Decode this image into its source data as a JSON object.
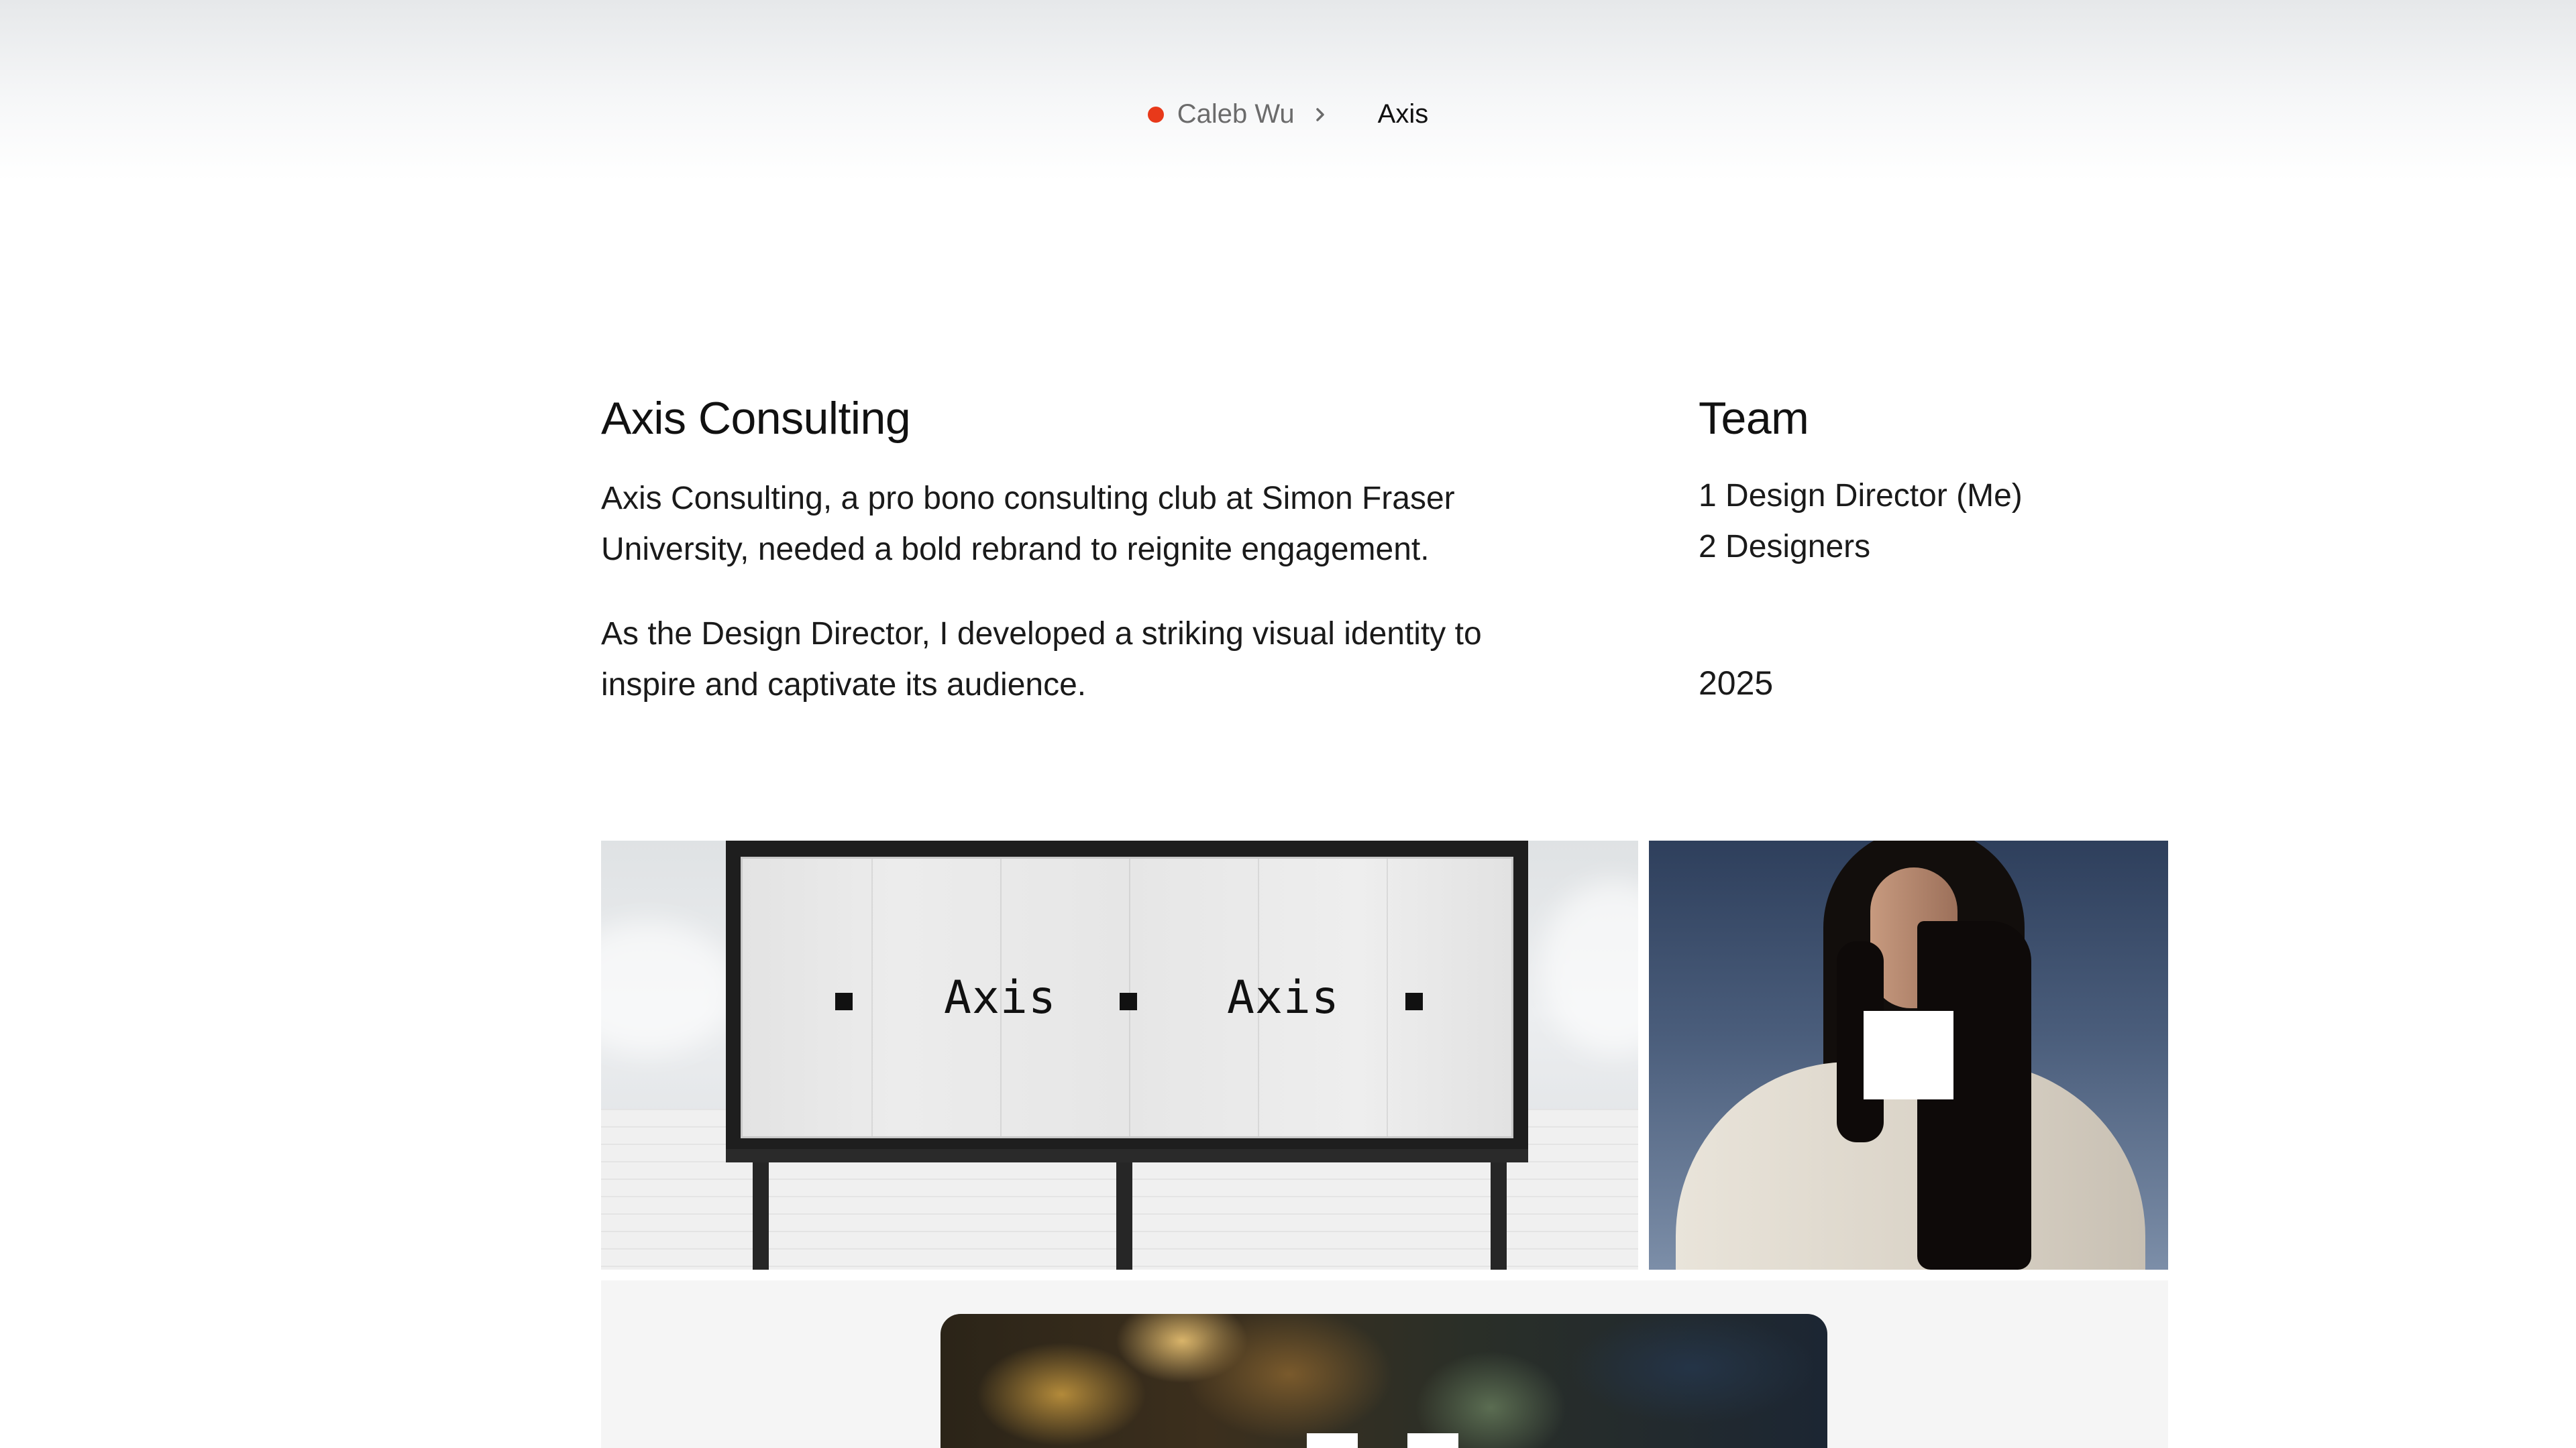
{
  "breadcrumb": {
    "home_label": "Caleb Wu",
    "current_label": "Axis",
    "accent_color": "#e8391a",
    "separator_icon": "chevron-right-icon"
  },
  "project": {
    "title": "Axis Consulting",
    "paragraphs": [
      "Axis Consulting, a pro bono consulting club at Simon Fraser University, needed a bold rebrand to reignite engagement.",
      "As the Design Director, I developed a striking visual identity to inspire and captivate its audience."
    ]
  },
  "team": {
    "title": "Team",
    "members": [
      "1 Design Director (Me)",
      "2 Designers"
    ],
    "year": "2025"
  },
  "gallery": {
    "billboard_words": [
      "Axis",
      "Axis"
    ]
  }
}
